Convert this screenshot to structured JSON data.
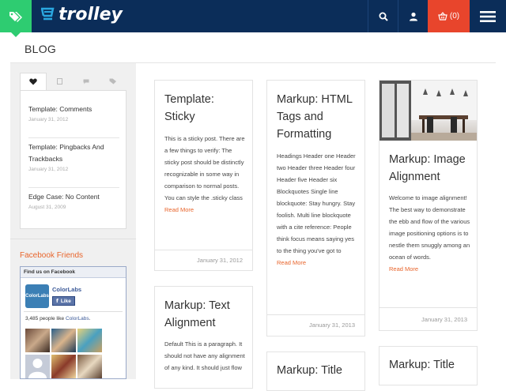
{
  "header": {
    "logo_text": "trolley",
    "cart_count": "(0)"
  },
  "page": {
    "title": "BLOG"
  },
  "sidebar": {
    "tabs": [
      "heart-icon",
      "square-icon",
      "comment-icon",
      "tag-icon"
    ],
    "recent_posts": [
      {
        "title": "Template: Comments",
        "date": "January 31, 2012"
      },
      {
        "title": "Template: Pingbacks And Trackbacks",
        "date": "January 31, 2012"
      },
      {
        "title": "Edge Case: No Content",
        "date": "August 31, 2009"
      }
    ],
    "facebook": {
      "title": "Facebook Friends",
      "box_header": "Find us on Facebook",
      "page_name": "ColorLabs",
      "logo_text": "ColorLabs",
      "like_label": "Like",
      "count_prefix": "3,485 people like ",
      "count_link": "ColorLabs",
      "count_suffix": "."
    }
  },
  "posts": [
    {
      "title": "Template: Sticky",
      "excerpt": "This is a sticky post. There are a few things to verify: The sticky post should be distinctly recognizable in some way in comparison to normal posts. You can style the .sticky class",
      "read_more": "Read More",
      "date": "January 31, 2012"
    },
    {
      "title": "Markup: HTML Tags and Formatting",
      "excerpt": "Headings Header one Header two Header three Header four Header five Header six Blockquotes Single line blockquote: Stay hungry. Stay foolish. Multi line blockquote with a cite reference: People think focus means saying yes to the thing you've got to",
      "read_more": "Read More",
      "date": "January 31, 2013"
    },
    {
      "title": "Markup: Image Alignment",
      "excerpt": "Welcome to image alignment! The best way to demonstrate the ebb and flow of the various image positioning options is to nestle them snuggly among an ocean of words.",
      "read_more": "Read More",
      "date": "January 31, 2013"
    },
    {
      "title": "Markup: Text Alignment",
      "excerpt": "Default This is a paragraph. It should not have any alignment of any kind. It should just flow"
    },
    {
      "title": "Markup: Title"
    },
    {
      "title": "Markup: Title"
    }
  ],
  "colors": {
    "header_bg": "#0b2d59",
    "accent_green": "#2ecc71",
    "cart_red": "#e8452c",
    "link_orange": "#e8652c"
  }
}
